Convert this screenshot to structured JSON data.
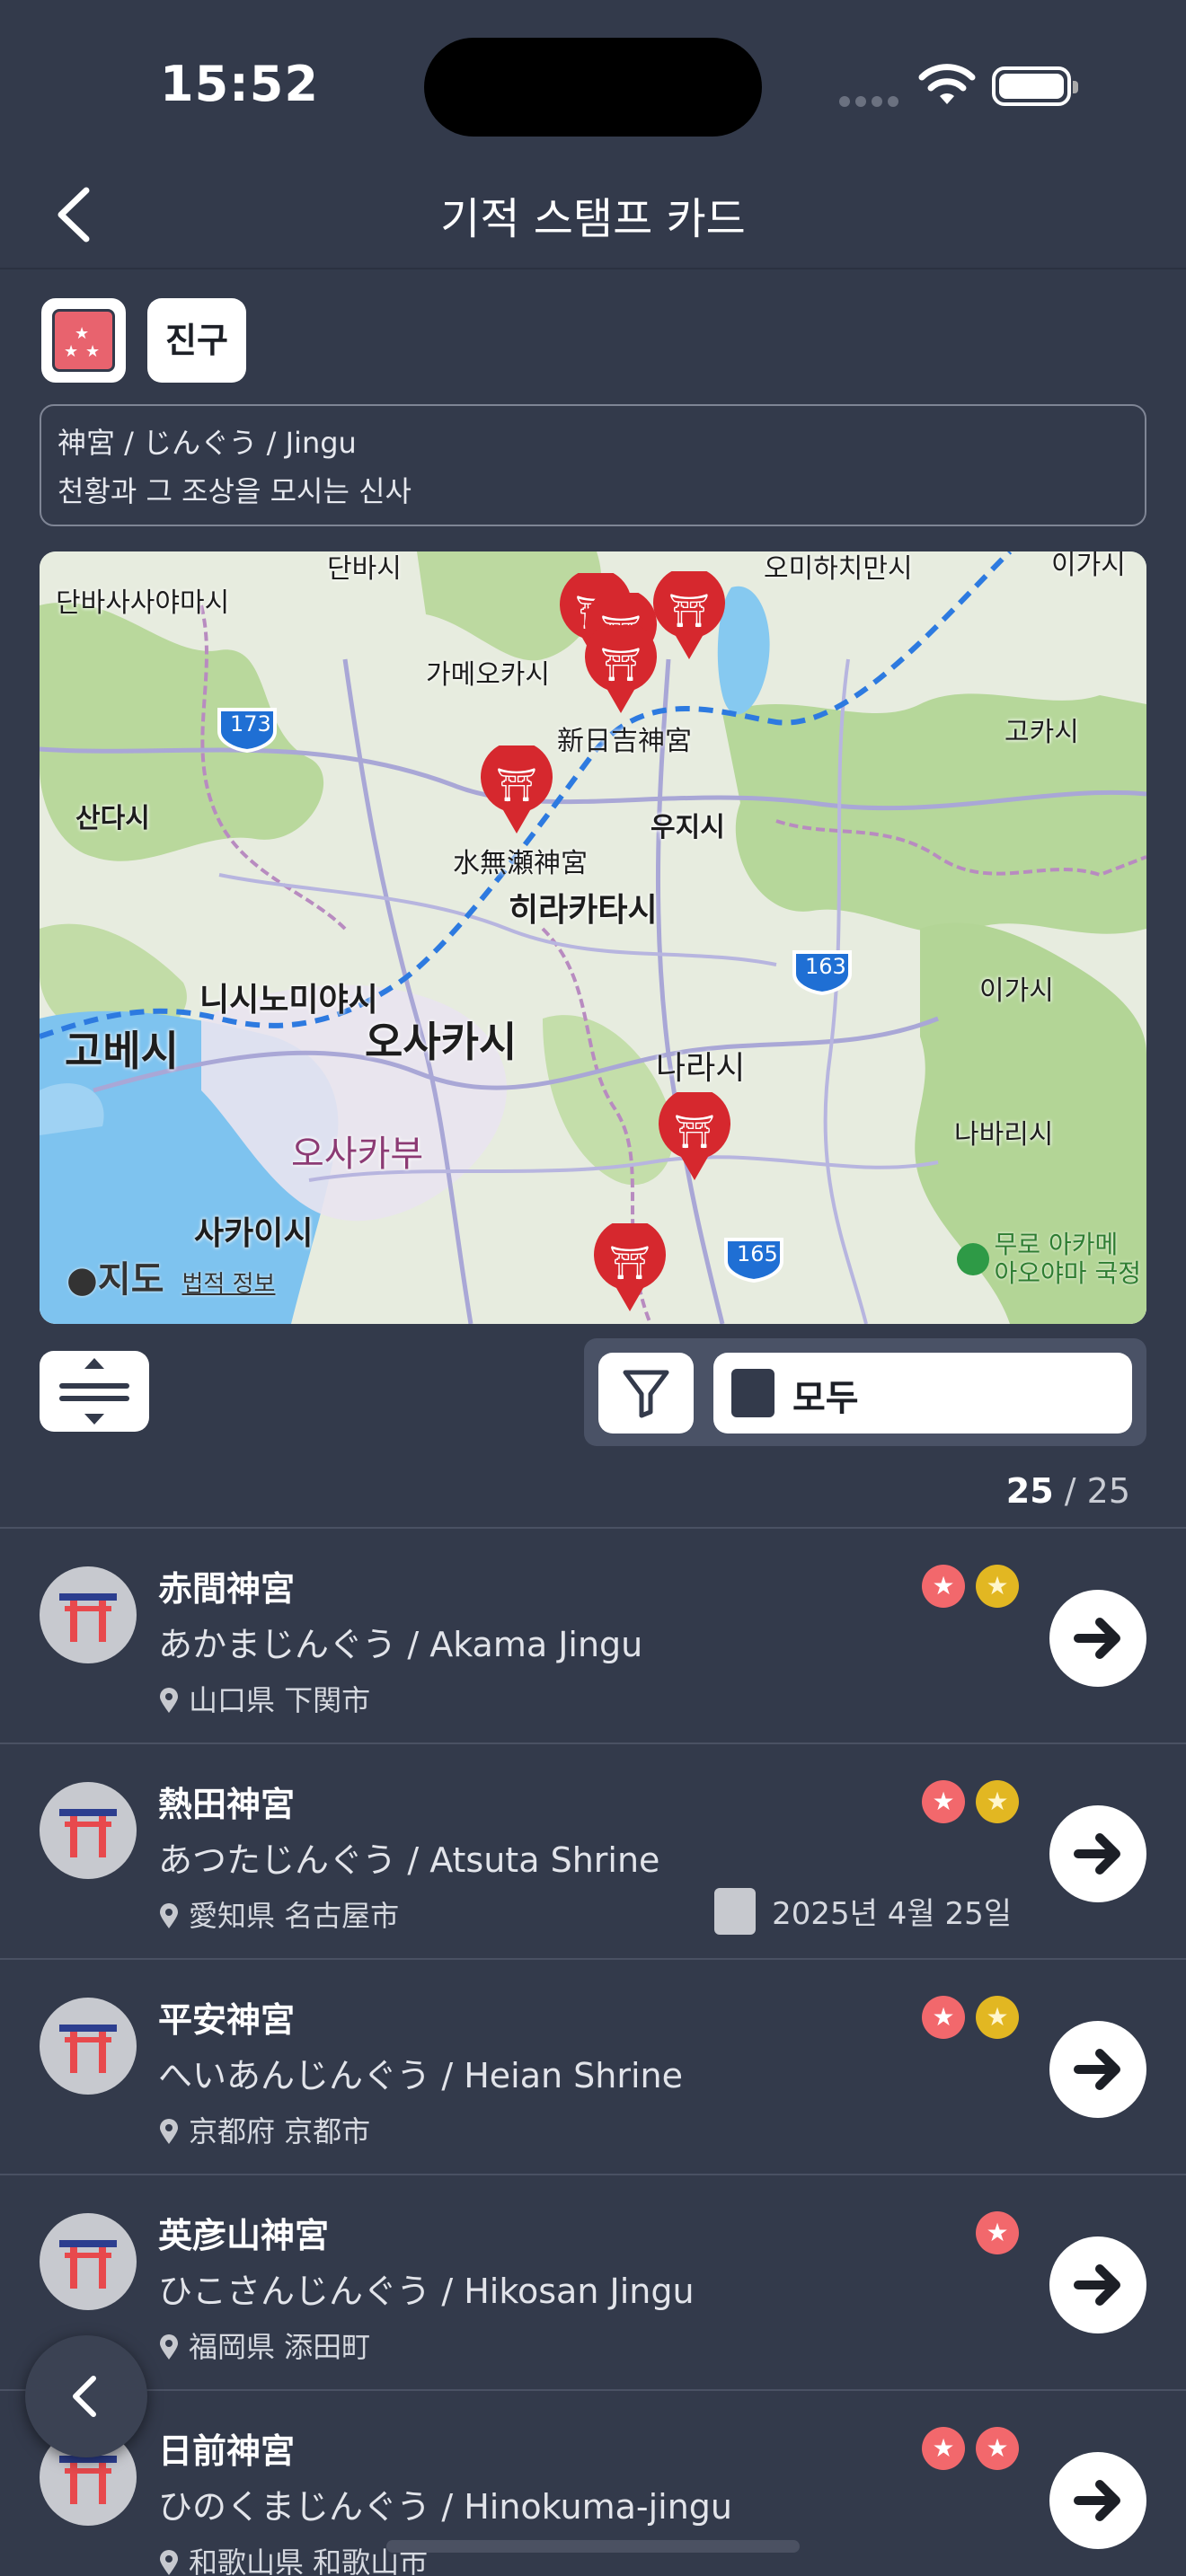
{
  "status_bar": {
    "time": "15:52"
  },
  "nav": {
    "title": "기적 스탬프 카드",
    "back_icon": "chevron-left-icon"
  },
  "filter_tag": {
    "label": "진구"
  },
  "description": {
    "line1": "神宮 / じんぐう / Jingu",
    "line2": "천황과 그 조상을 모시는 신사"
  },
  "map": {
    "labels": {
      "tanba_sasayama": "단바사사야마시",
      "tanba": "단바시",
      "kameoka": "가메오카시",
      "omihachiman": "오미하치만시",
      "iga_top": "이가시",
      "koka": "고카시",
      "sanda": "산다시",
      "uji": "우지시",
      "hirakata": "히라카타시",
      "nishinomiya": "니시노미야시",
      "kobe": "고베시",
      "osaka_city": "오사카시",
      "osaka_pref": "오사카부",
      "nara": "나라시",
      "iga": "이가시",
      "nabari": "나바리시",
      "sakai": "사카이시",
      "shinhiyoshi": "新日吉神宮",
      "minase": "水無瀬神宮",
      "route_173": "173",
      "route_163": "163",
      "route_165": "165",
      "park": "무로 아카메\n아오야마 국정"
    },
    "footer": {
      "brand": "지도",
      "legal": "법적 정보"
    }
  },
  "controls": {
    "all_label": "모두"
  },
  "count": {
    "shown": "25",
    "total": "25"
  },
  "shrines": [
    {
      "name": "赤間神宮",
      "reading": "あかまじんぐう / Akama Jingu",
      "location": "山口県 下関市",
      "date": "",
      "badges": [
        "red",
        "gold"
      ]
    },
    {
      "name": "熱田神宮",
      "reading": "あつたじんぐう / Atsuta Shrine",
      "location": "愛知県 名古屋市",
      "date": "2025년 4월 25일",
      "badges": [
        "red",
        "gold"
      ]
    },
    {
      "name": "平安神宮",
      "reading": "へいあんじんぐう / Heian Shrine",
      "location": "京都府 京都市",
      "date": "",
      "badges": [
        "red",
        "gold"
      ]
    },
    {
      "name": "英彦山神宮",
      "reading": "ひこさんじんぐう / Hikosan Jingu",
      "location": "福岡県 添田町",
      "date": "",
      "badges": [
        "red"
      ]
    },
    {
      "name": "日前神宮",
      "reading": "ひのくまじんぐう / Hinokuma-jingu",
      "location": "和歌山県 和歌山市",
      "date": "",
      "badges": [
        "red",
        "red"
      ]
    }
  ],
  "colors": {
    "background": "#333a4b",
    "pin": "#d6282e",
    "badge_red": "#f2686c",
    "badge_gold": "#e2b722"
  }
}
